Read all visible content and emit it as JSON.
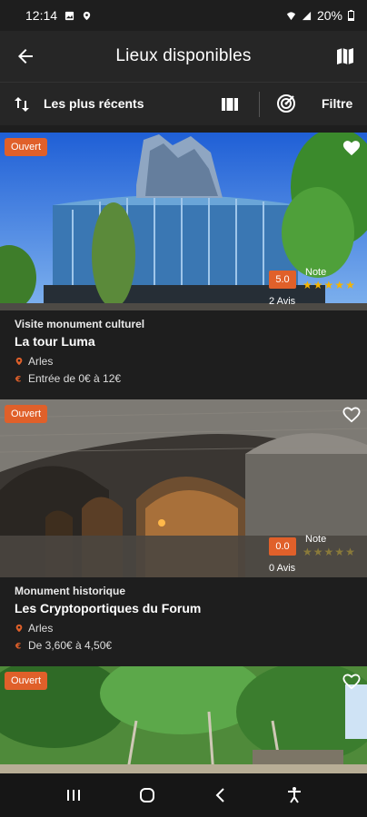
{
  "status_bar": {
    "time": "12:14",
    "battery": "20%"
  },
  "app_bar": {
    "title": "Lieux disponibles"
  },
  "filter_bar": {
    "sort_label": "Les plus récents",
    "filter_label": "Filtre"
  },
  "cards": [
    {
      "badge": "Ouvert",
      "rating": "5.0",
      "note_label": "Note",
      "stars_filled": 5,
      "reviews": "2 Avis",
      "type": "Visite monument culturel",
      "name": "La tour Luma",
      "city": "Arles",
      "price": "Entrée de 0€ à 12€"
    },
    {
      "badge": "Ouvert",
      "rating": "0.0",
      "note_label": "Note",
      "stars_filled": 0,
      "reviews": "0 Avis",
      "type": "Monument historique",
      "name": "Les Cryptoportiques du Forum",
      "city": "Arles",
      "price": "De 3,60€ à 4,50€"
    },
    {
      "badge": "Ouvert"
    }
  ],
  "colors": {
    "accent": "#e0602a",
    "background": "#1e1e1e",
    "star_filled": "#f5b400",
    "star_empty": "#8a7a3a"
  }
}
